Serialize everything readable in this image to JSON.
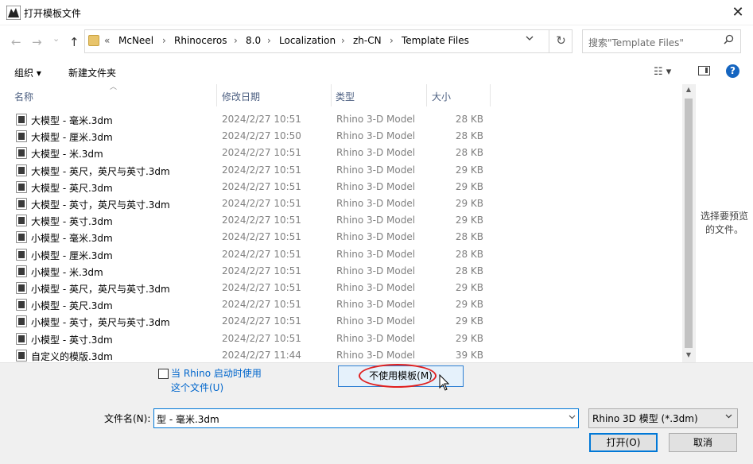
{
  "window": {
    "title": "打开模板文件"
  },
  "nav": {
    "back": "←",
    "forward": "→",
    "recent": "⌄",
    "up": "↑",
    "path_prefix": "«",
    "breadcrumbs": [
      "McNeel",
      "Rhinoceros",
      "8.0",
      "Localization",
      "zh-CN",
      "Template Files"
    ],
    "separator": "›",
    "refresh": "↻",
    "search_placeholder": "搜索\"Template Files\""
  },
  "toolbar": {
    "organize": "组织 ▾",
    "new_folder": "新建文件夹",
    "view": "☷ ▾",
    "help": "?"
  },
  "columns": {
    "name": "名称",
    "date": "修改日期",
    "type": "类型",
    "size": "大小"
  },
  "files": [
    {
      "name": "大模型 - 毫米.3dm",
      "date": "2024/2/27 10:51",
      "type": "Rhino 3-D Model",
      "size": "28 KB"
    },
    {
      "name": "大模型 - 厘米.3dm",
      "date": "2024/2/27 10:50",
      "type": "Rhino 3-D Model",
      "size": "28 KB"
    },
    {
      "name": "大模型 - 米.3dm",
      "date": "2024/2/27 10:51",
      "type": "Rhino 3-D Model",
      "size": "28 KB"
    },
    {
      "name": "大模型 - 英尺，英尺与英寸.3dm",
      "date": "2024/2/27 10:51",
      "type": "Rhino 3-D Model",
      "size": "29 KB"
    },
    {
      "name": "大模型 - 英尺.3dm",
      "date": "2024/2/27 10:51",
      "type": "Rhino 3-D Model",
      "size": "29 KB"
    },
    {
      "name": "大模型 - 英寸，英尺与英寸.3dm",
      "date": "2024/2/27 10:51",
      "type": "Rhino 3-D Model",
      "size": "29 KB"
    },
    {
      "name": "大模型 - 英寸.3dm",
      "date": "2024/2/27 10:51",
      "type": "Rhino 3-D Model",
      "size": "29 KB"
    },
    {
      "name": "小模型 - 毫米.3dm",
      "date": "2024/2/27 10:51",
      "type": "Rhino 3-D Model",
      "size": "28 KB"
    },
    {
      "name": "小模型 - 厘米.3dm",
      "date": "2024/2/27 10:51",
      "type": "Rhino 3-D Model",
      "size": "28 KB"
    },
    {
      "name": "小模型 - 米.3dm",
      "date": "2024/2/27 10:51",
      "type": "Rhino 3-D Model",
      "size": "28 KB"
    },
    {
      "name": "小模型 - 英尺，英尺与英寸.3dm",
      "date": "2024/2/27 10:51",
      "type": "Rhino 3-D Model",
      "size": "29 KB"
    },
    {
      "name": "小模型 - 英尺.3dm",
      "date": "2024/2/27 10:51",
      "type": "Rhino 3-D Model",
      "size": "29 KB"
    },
    {
      "name": "小模型 - 英寸，英尺与英寸.3dm",
      "date": "2024/2/27 10:51",
      "type": "Rhino 3-D Model",
      "size": "29 KB"
    },
    {
      "name": "小模型 - 英寸.3dm",
      "date": "2024/2/27 10:51",
      "type": "Rhino 3-D Model",
      "size": "29 KB"
    },
    {
      "name": "自定义的模版.3dm",
      "date": "2024/2/27 11:44",
      "type": "Rhino 3-D Model",
      "size": "39 KB"
    }
  ],
  "preview": {
    "text": "选择要预览的文件。"
  },
  "options": {
    "use_on_startup_line1": "当 Rhino 启动时使用",
    "use_on_startup_line2": "这个文件(U)",
    "no_template_button": "不使用模板(M)"
  },
  "footer": {
    "filename_label": "文件名(N):",
    "filename_value": "型 - 毫米.3dm",
    "filter_value": "Rhino 3D 模型 (*.3dm)",
    "open_button": "打开(O)",
    "cancel_button": "取消"
  },
  "colors": {
    "accent": "#0078d7",
    "link": "#0066cc",
    "annotation_red": "#e02020"
  }
}
